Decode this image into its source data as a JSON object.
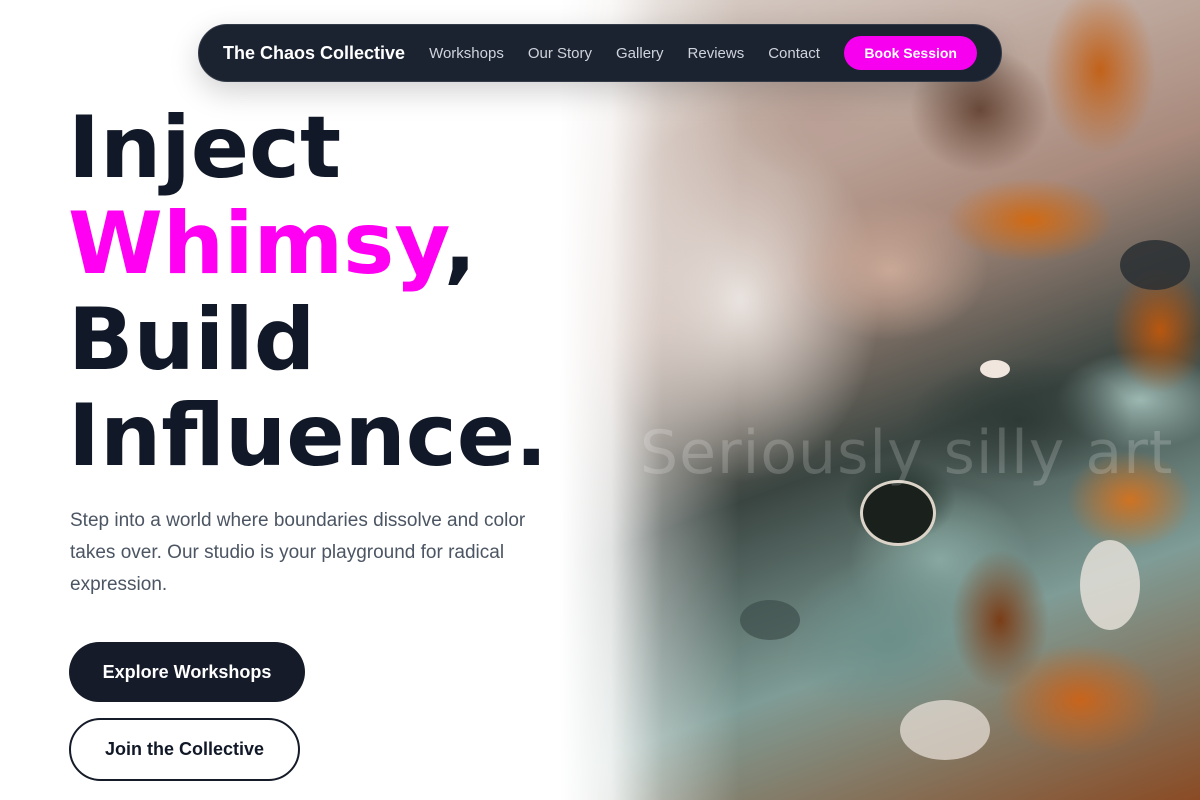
{
  "nav": {
    "brand": "The Chaos Collective",
    "links": [
      "Workshops",
      "Our Story",
      "Gallery",
      "Reviews",
      "Contact"
    ],
    "cta": "Book Session"
  },
  "hero": {
    "title_line1": "Inject",
    "title_accent": "Whimsy",
    "title_comma": ",",
    "title_line3": "Build",
    "title_line4": "Influence.",
    "subtitle": "Step into a world where boundaries dissolve and color takes over. Our studio is your playground for radical expression.",
    "primary_button": "Explore Workshops",
    "secondary_button": "Join the Collective"
  },
  "artwork": {
    "ghost_text": "Seriously silly art"
  },
  "colors": {
    "accent": "#ff00f2",
    "dark": "#151b28",
    "nav_bg": "#1b2230",
    "text": "#111827",
    "muted": "#4b5563"
  }
}
